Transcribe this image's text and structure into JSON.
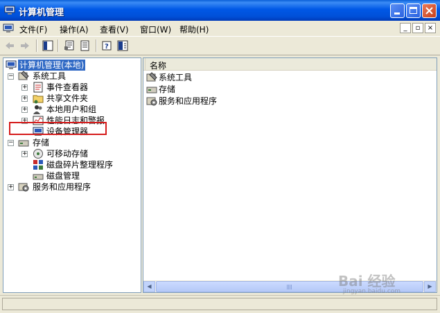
{
  "window": {
    "title": "计算机管理"
  },
  "menu": {
    "items": [
      "文件(F)",
      "操作(A)",
      "查看(V)",
      "窗口(W)",
      "帮助(H)"
    ]
  },
  "tree": {
    "root": "计算机管理(本地)",
    "system_tools": "系统工具",
    "event_viewer": "事件查看器",
    "shared_folders": "共享文件夹",
    "local_users": "本地用户和组",
    "perf_logs": "性能日志和警报",
    "device_manager": "设备管理器",
    "storage": "存储",
    "removable": "可移动存储",
    "defrag": "磁盘碎片整理程序",
    "disk_mgmt": "磁盘管理",
    "services": "服务和应用程序"
  },
  "list": {
    "column_name": "名称",
    "items": [
      "系统工具",
      "存储",
      "服务和应用程序"
    ]
  },
  "watermark": {
    "brand": "Bai 经验",
    "url": "jingyan.baidu.com"
  },
  "colors": {
    "title_bar": "#0055e5",
    "selection": "#316ac5",
    "highlight_box": "#d51a1a"
  }
}
